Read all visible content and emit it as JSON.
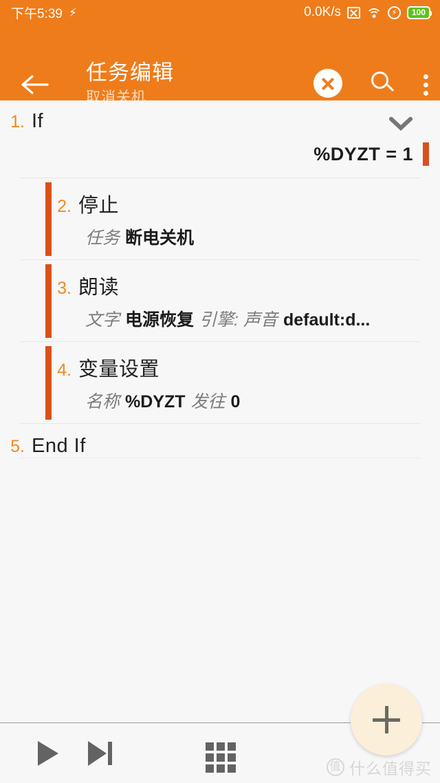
{
  "status_bar": {
    "clock": "下午5:39",
    "charging_icon": "bolt-icon",
    "network_speed": "0.0K/s",
    "icons": [
      "x-box-icon",
      "wifi-icon",
      "flash-circle-icon",
      "battery-icon"
    ],
    "battery_level": "100",
    "battery_color": "#5bc419",
    "background": "#ef7c1a"
  },
  "app_bar": {
    "back_label": "←",
    "title": "任务编辑",
    "subtitle": "取消关机",
    "actions": [
      "close-circle-icon",
      "search-icon",
      "more-vert-icon"
    ],
    "background": "#ef7c1a",
    "title_color": "#ffffff",
    "subtitle_color": "#fbd9b6"
  },
  "accent_colors": {
    "number": "#ef8b1f",
    "bar": "#d9501b",
    "orange": "#ef7c1a"
  },
  "actions": [
    {
      "number": "1.",
      "name": "If",
      "indented": false,
      "has_chevron": true,
      "condition": "%DYZT = 1",
      "sub": []
    },
    {
      "number": "2.",
      "name": "停止",
      "indented": true,
      "has_chevron": false,
      "condition": "",
      "sub": [
        {
          "label": "任务",
          "value": "断电关机"
        }
      ]
    },
    {
      "number": "3.",
      "name": "朗读",
      "indented": true,
      "has_chevron": false,
      "condition": "",
      "sub": [
        {
          "label": "文字",
          "value": "电源恢复"
        },
        {
          "label": "引擎: 声音",
          "value": "default:d..."
        }
      ]
    },
    {
      "number": "4.",
      "name": "变量设置",
      "indented": true,
      "has_chevron": false,
      "condition": "",
      "sub": [
        {
          "label": "名称",
          "value": "%DYZT"
        },
        {
          "label": "发往",
          "value": "0"
        }
      ]
    },
    {
      "number": "5.",
      "name": "End If",
      "indented": false,
      "has_chevron": false,
      "condition": "",
      "sub": []
    }
  ],
  "bottom_bar": {
    "buttons": [
      "play-icon",
      "step-forward-icon",
      "grid-icon"
    ],
    "fab_label": "+",
    "fab_color": "#fbefda"
  },
  "watermark": {
    "logo_text": "值",
    "text": "什么值得买"
  }
}
